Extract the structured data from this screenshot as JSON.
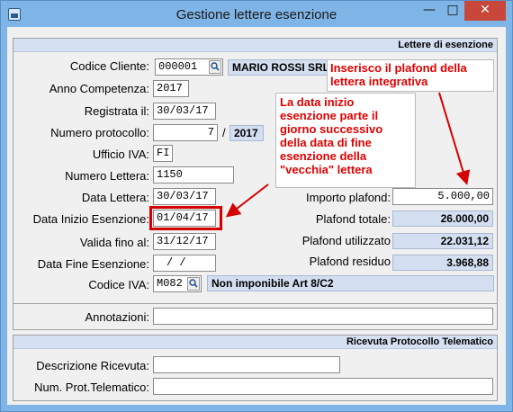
{
  "window": {
    "title": "Gestione lettere esenzione",
    "minimize": "—",
    "maximize": "□",
    "close": "✕"
  },
  "sections": {
    "lettere": "Lettere di esenzione",
    "ricevuta": "Ricevuta Protocollo Telematico"
  },
  "labels": {
    "codice_cliente": "Codice Cliente:",
    "anno_competenza": "Anno Competenza:",
    "registrata_il": "Registrata il:",
    "numero_protocollo": "Numero protocollo:",
    "ufficio_iva": "Ufficio IVA:",
    "numero_lettera": "Numero Lettera:",
    "data_lettera": "Data Lettera:",
    "data_inizio": "Data Inizio Esenzione:",
    "valida_fino": "Valida fino al:",
    "data_fine": "Data Fine Esenzione:",
    "codice_iva": "Codice IVA:",
    "importo_plafond": "Importo plafond:",
    "plafond_totale": "Plafond totale:",
    "plafond_utilizzato": "Plafond utilizzato",
    "plafond_residuo": "Plafond residuo",
    "annotazioni": "Annotazioni:",
    "descrizione_ricevuta": "Descrizione Ricevuta:",
    "num_prot_telematico": "Num. Prot.Telematico:"
  },
  "values": {
    "codice_cliente": "000001",
    "cliente_nome": "MARIO ROSSI SRL",
    "anno_competenza": "2017",
    "registrata_il": "30/03/17",
    "numero_protocollo": "7",
    "protocollo_sep": "/",
    "protocollo_anno": "2017",
    "ufficio_iva": "FI",
    "numero_lettera": "1150",
    "data_lettera": "30/03/17",
    "data_inizio": "01/04/17",
    "valida_fino": "31/12/17",
    "data_fine": "/  /",
    "codice_iva": "M082",
    "codice_iva_desc": "Non imponibile Art 8/C2",
    "importo_plafond": "5.000,00",
    "plafond_totale": "26.000,00",
    "plafond_utilizzato": "22.031,12",
    "plafond_residuo": "3.968,88",
    "annotazioni": "",
    "descrizione_ricevuta": "",
    "num_prot_telematico": ""
  },
  "annotations": {
    "note_plafond_line1": "Inserisco il plafond della",
    "note_plafond_line2": "lettera integrativa",
    "note_date_line1": "La data inizio",
    "note_date_line2": "esenzione parte il",
    "note_date_line3": "giorno successivo",
    "note_date_line4": "della data di fine",
    "note_date_line5": "esenzione della",
    "note_date_line6": "\"vecchia\" lettera"
  },
  "colors": {
    "titlebar": "#7fb4e6",
    "close": "#c7483b",
    "readonly": "#d3dff0",
    "annotation": "#d40000"
  },
  "icons": {
    "lookup": "magnifier-icon",
    "app": "form-icon"
  }
}
